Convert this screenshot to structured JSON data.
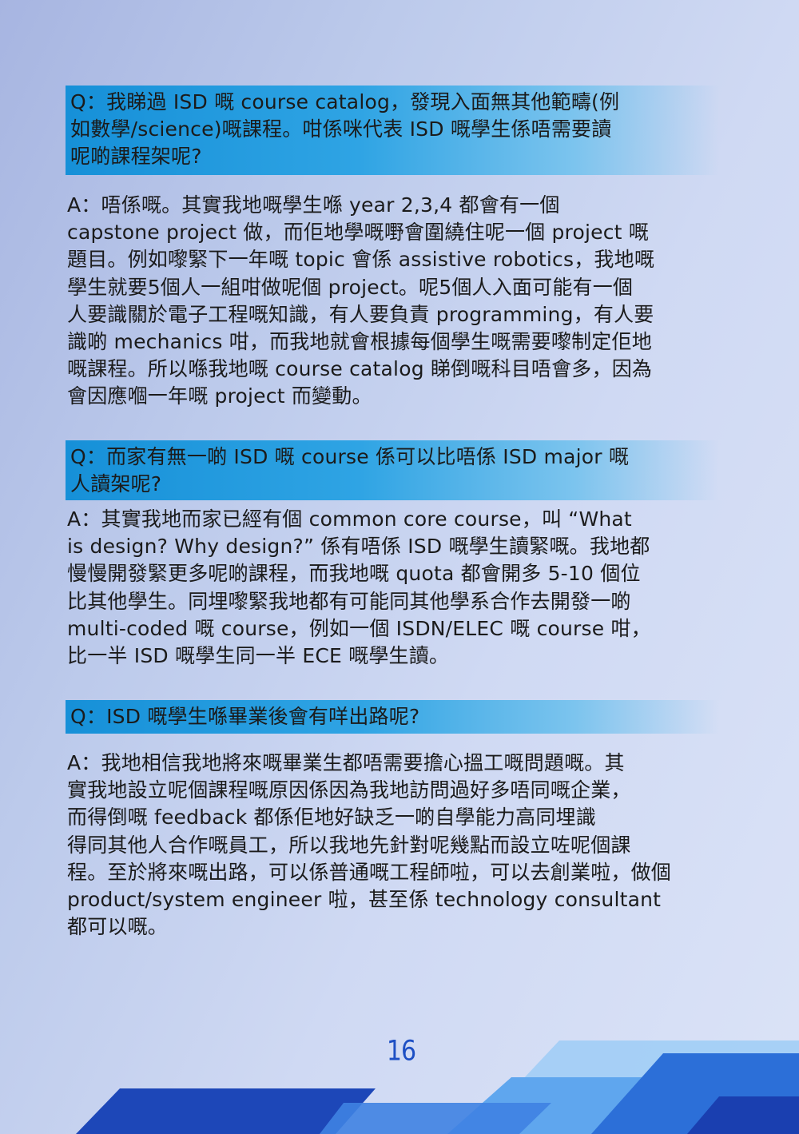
{
  "qa": [
    {
      "question": "Q：我睇過 ISD 嘅 course catalog，發現入面無其他範疇(例\n如數學/science)嘅課程。咁係咪代表 ISD 嘅學生係唔需要讀\n呢啲課程架呢?",
      "answer": "A：唔係嘅。其實我地嘅學生喺 year 2,3,4 都會有一個\ncapstone project 做，而佢地學嘅嘢會圍繞住呢一個 project 嘅\n題目。例如嚟緊下一年嘅 topic 會係 assistive robotics，我地嘅\n學生就要5個人一組咁做呢個 project。呢5個人入面可能有一個\n人要識關於電子工程嘅知識，有人要負責 programming，有人要\n識啲 mechanics 咁，而我地就會根據每個學生嘅需要嚟制定佢地\n嘅課程。所以喺我地嘅 course catalog 睇倒嘅科目唔會多，因為\n會因應嗰一年嘅 project 而變動。"
    },
    {
      "question": "Q：而家有無一啲 ISD 嘅 course 係可以比唔係 ISD major 嘅\n人讀架呢?",
      "answer": "A：其實我地而家已經有個 common core course，叫 “What\nis design? Why design?” 係有唔係 ISD 嘅學生讀緊嘅。我地都\n慢慢開發緊更多呢啲課程，而我地嘅 quota 都會開多 5-10 個位\n比其他學生。同埋嚟緊我地都有可能同其他學系合作去開發一啲\nmulti-coded 嘅 course，例如一個 ISDN/ELEC 嘅 course 咁，\n比一半 ISD 嘅學生同一半 ECE 嘅學生讀。"
    },
    {
      "question": "Q：ISD 嘅學生喺畢業後會有咩出路呢?",
      "answer": "A：我地相信我地將來嘅畢業生都唔需要擔心搵工嘅問題嘅。其\n實我地設立呢個課程嘅原因係因為我地訪問過好多唔同嘅企業，\n而得倒嘅 feedback 都係佢地好缺乏一啲自學能力高同埋識\n得同其他人合作嘅員工，所以我地先針對呢幾點而設立咗呢個課\n程。至於將來嘅出路，可以係普通嘅工程師啦，可以去創業啦，做個\nproduct/system engineer 啦，甚至係 technology consultant\n都可以嘅。"
    }
  ],
  "page_number": "16",
  "colors": {
    "question_bar": "#1690d8",
    "page_number": "#1d4fc4",
    "deco_dark": "#1a3fb0",
    "deco_light": "#8fc3f4"
  }
}
